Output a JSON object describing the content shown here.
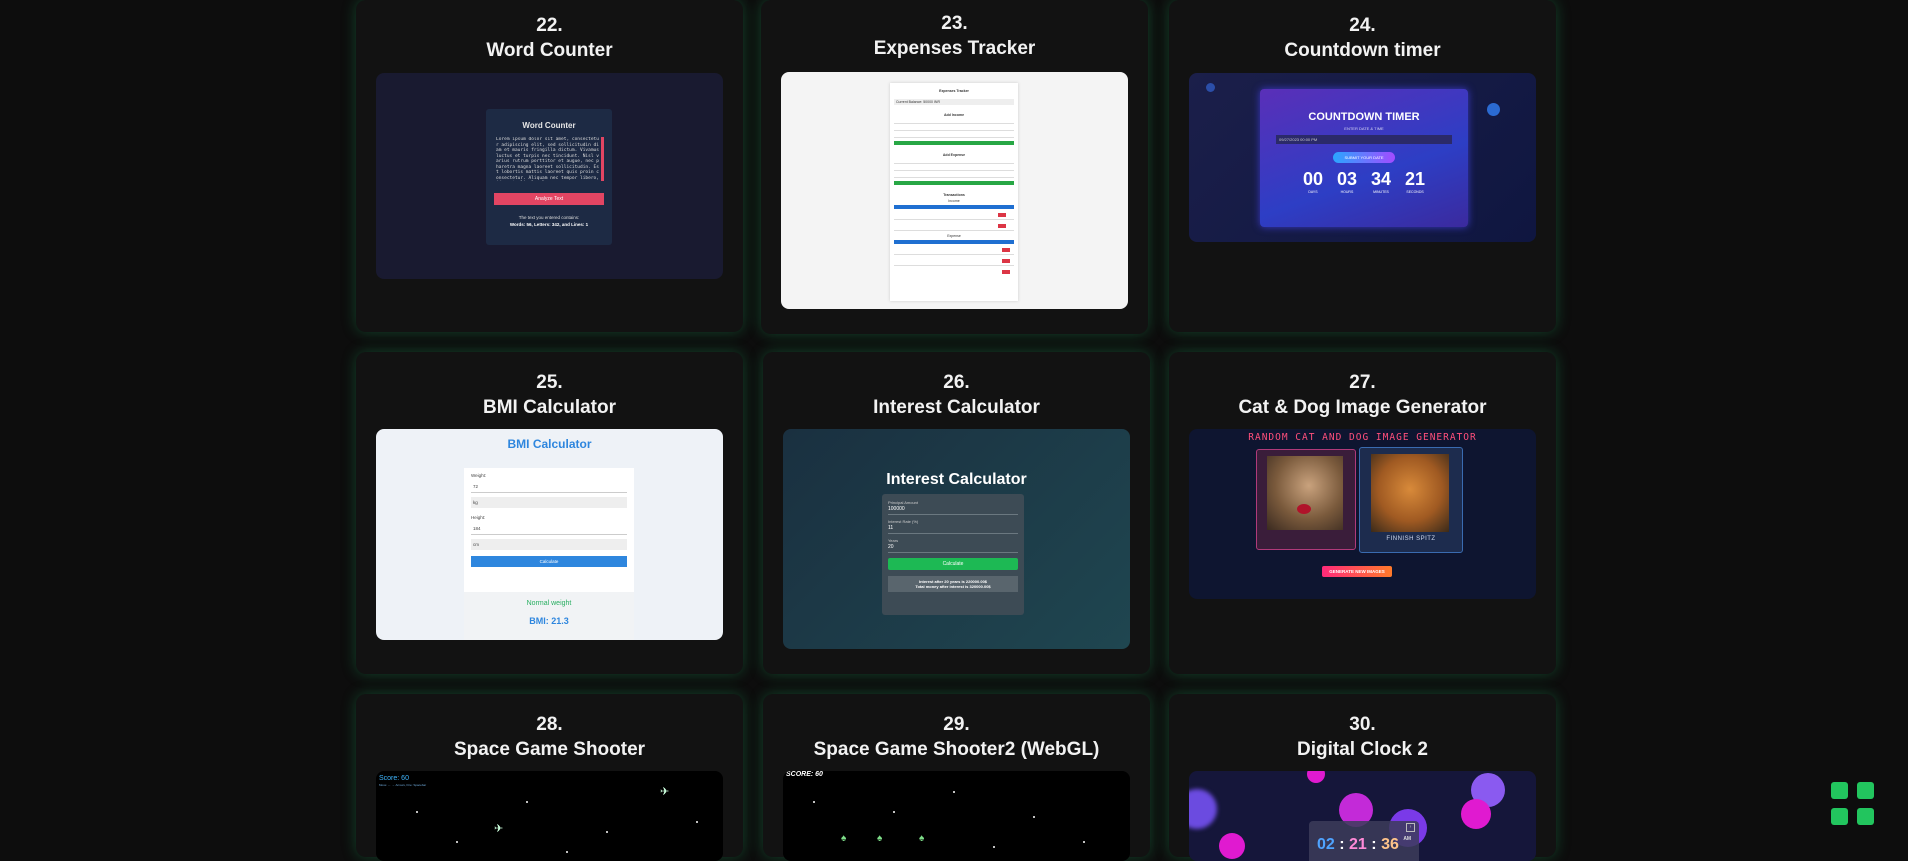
{
  "projects": [
    {
      "number": "22.",
      "title": "Word Counter",
      "preview": {
        "heading": "Word Counter",
        "sample": "Lorem ipsum dolor sit amet, consectetur adipiscing elit, sed sollicitudin diam et mauris fringilla dictum. Vivamus luctus et turpis nec tincidunt. Nisl varius rutrum porttitor et augue, nec pharetra magna laoreet sollicitudin. Est lobortis mattis laoreet quis proin consectetur. Aliquam nec tempor libero, id porta ligula, lorem.",
        "button": "Analyze Text",
        "result1": "The text you entered contains:",
        "result2": "Words: 56, Letters: 342, and Lines: 1"
      }
    },
    {
      "number": "23.",
      "title": "Expenses Tracker",
      "preview": {
        "heading": "Expenses Tracker",
        "balance": "Current Balance: 50000 INR",
        "sec1": "Add Income",
        "sec2": "Add Expense",
        "sec3": "Transactions",
        "sub1": "Income",
        "sub2": "Expense"
      }
    },
    {
      "number": "24.",
      "title": "Countdown timer",
      "preview": {
        "heading": "COUNTDOWN TIMER",
        "sub": "ENTER DATE & TIME",
        "input": "09/27/2023 00:00 PM",
        "button": "SUBMIT YOUR DATE",
        "days": "00",
        "hours": "03",
        "minutes": "34",
        "seconds": "21",
        "l_days": "DAYS",
        "l_hours": "HOURS",
        "l_minutes": "MINUTES",
        "l_seconds": "SECONDS"
      }
    },
    {
      "number": "25.",
      "title": "BMI Calculator",
      "preview": {
        "heading": "BMI Calculator",
        "weight_label": "Weight:",
        "weight_value": "72",
        "weight_unit": "kg",
        "height_label": "Height:",
        "height_value": "184",
        "height_unit": "cm",
        "button": "Calculate",
        "status": "Normal weight",
        "bmi": "BMI: 21.3"
      }
    },
    {
      "number": "26.",
      "title": "Interest Calculator",
      "preview": {
        "heading": "Interest Calculator",
        "principal_label": "Principal Amount",
        "principal_value": "100000",
        "rate_label": "Interest Rate (%)",
        "rate_value": "11",
        "years_label": "Years",
        "years_value": "20",
        "button": "Calculate",
        "result1": "Interest after 20 years is 220000.00$",
        "result2": "Total money after interest is 320000.00$"
      }
    },
    {
      "number": "27.",
      "title": "Cat & Dog Image Generator",
      "preview": {
        "heading": "RANDOM CAT AND DOG IMAGE GENERATOR",
        "breed": "FINNISH SPITZ",
        "button": "GENERATE NEW IMAGES"
      }
    },
    {
      "number": "28.",
      "title": "Space Game Shooter",
      "preview": {
        "score": "Score: 60",
        "hint": "Move: ← → Arrows, Fire: Spacebar"
      }
    },
    {
      "number": "29.",
      "title": "Space Game Shooter2 (WebGL)",
      "preview": {
        "score": "SCORE: 60"
      }
    },
    {
      "number": "30.",
      "title": "Digital Clock 2",
      "preview": {
        "hours": "02",
        "minutes": "21",
        "seconds": "36",
        "sep": ":",
        "ampm": "AM"
      }
    }
  ],
  "colors": {
    "accent": "#22c55e",
    "card_bg": "#121212",
    "page_bg": "#0d0d0d"
  },
  "floating_icon": "grid-icon"
}
